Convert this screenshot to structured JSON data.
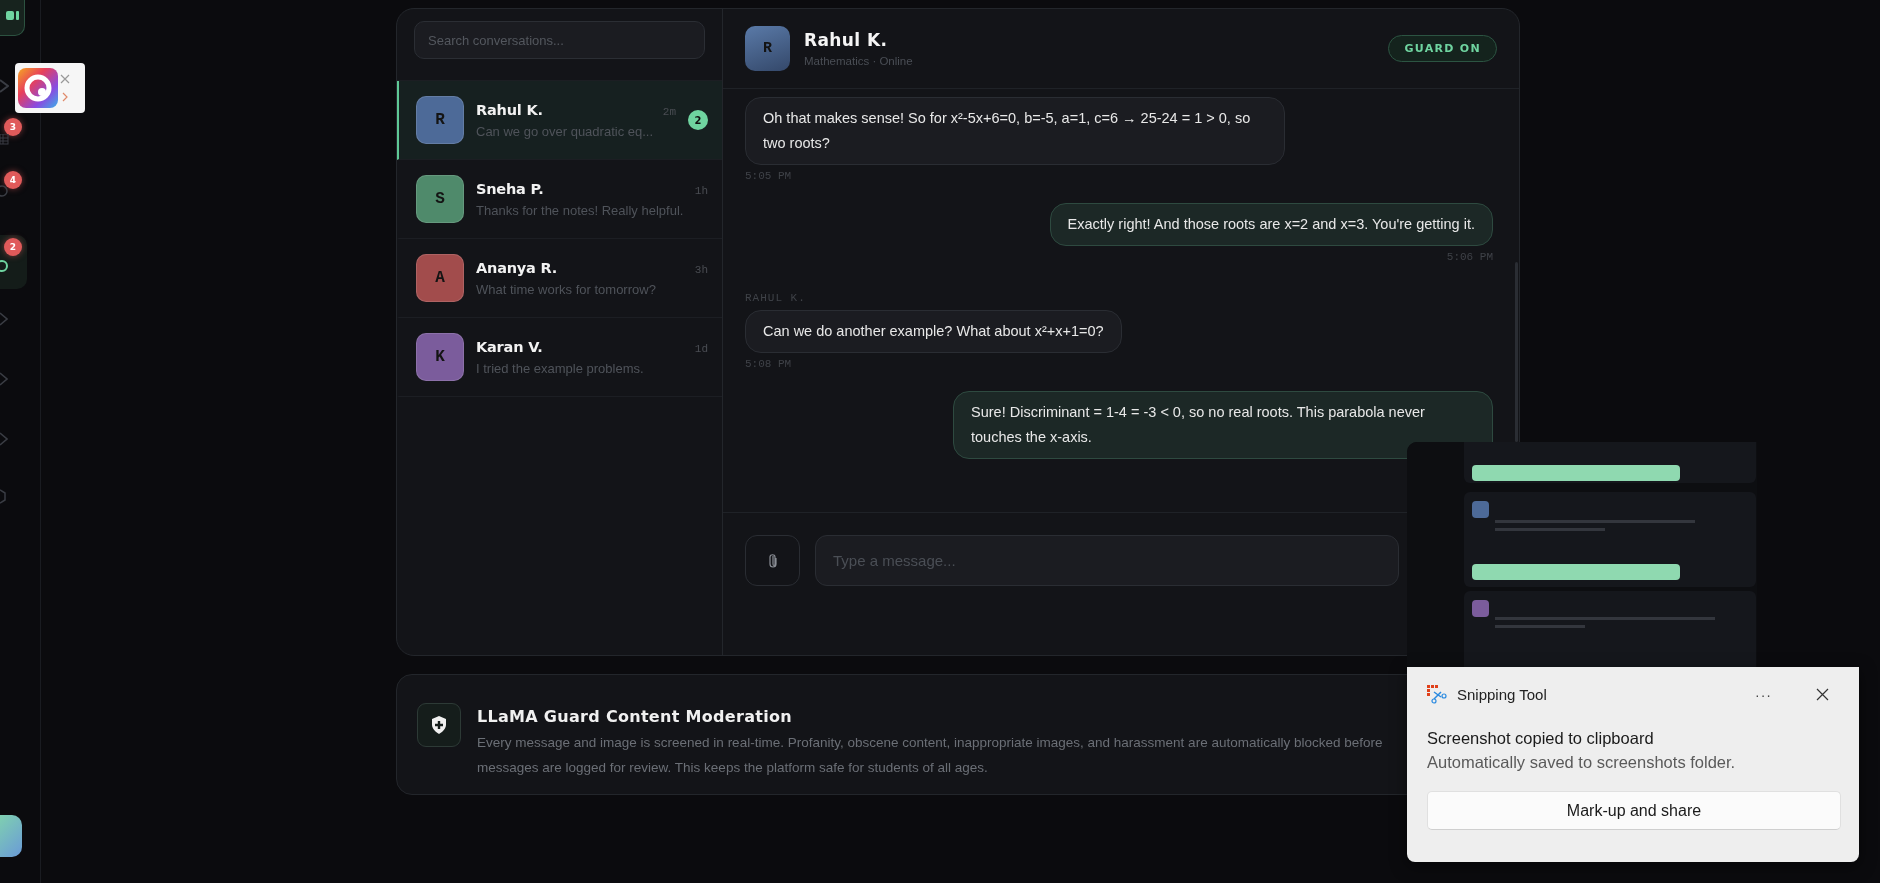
{
  "rail": {
    "badges": [
      {
        "count": "3"
      },
      {
        "count": "4"
      },
      {
        "count": "2"
      }
    ]
  },
  "search": {
    "placeholder": "Search conversations..."
  },
  "conversations": [
    {
      "initial": "R",
      "name": "Rahul K.",
      "preview": "Can we go over quadratic eq...",
      "time": "2m",
      "unread": "2",
      "selected": true,
      "color": "#4d6a98"
    },
    {
      "initial": "S",
      "name": "Sneha P.",
      "preview": "Thanks for the notes! Really helpful.",
      "time": "1h",
      "selected": false,
      "color": "#4f8a6b"
    },
    {
      "initial": "A",
      "name": "Ananya R.",
      "preview": "What time works for tomorrow?",
      "time": "3h",
      "selected": false,
      "color": "#a24c4c"
    },
    {
      "initial": "K",
      "name": "Karan V.",
      "preview": "I tried the example problems.",
      "time": "1d",
      "selected": false,
      "color": "#7b5c9c"
    }
  ],
  "chat": {
    "initial": "R",
    "name": "Rahul K.",
    "status": "Mathematics · Online",
    "guard": "GUARD ON",
    "messages": [
      {
        "kind": "incoming",
        "text": "Oh that makes sense! So for x²-5x+6=0, b=-5, a=1, c=6 → 25-24 = 1 > 0, so two roots?",
        "time": "5:05 PM"
      },
      {
        "kind": "outgoing",
        "text": "Exactly right! And those roots are x=2 and x=3. You're getting it.",
        "time": "5:06 PM"
      },
      {
        "kind": "sender",
        "text": "RAHUL K."
      },
      {
        "kind": "incoming",
        "text": "Can we do another example? What about x²+x+1=0?",
        "time": "5:08 PM"
      },
      {
        "kind": "outgoing",
        "text": "Sure! Discriminant = 1-4 = -3 < 0, so no real roots. This parabola never touches the x-axis."
      }
    ],
    "composer": {
      "placeholder": "Type a message..."
    }
  },
  "moderation": {
    "title": "LLaMA Guard Content Moderation",
    "description": "Every message and image is screened in real-time. Profanity, obscene content, inappropriate images, and harassment are automatically blocked before\nmessages are logged for review. This keeps the platform safe for students of all ages."
  },
  "snipping_tool": {
    "app": "Snipping Tool",
    "menu": "···",
    "heading": "Screenshot copied to clipboard",
    "detail": "Automatically saved to screenshots folder.",
    "action": "Mark-up and share"
  }
}
